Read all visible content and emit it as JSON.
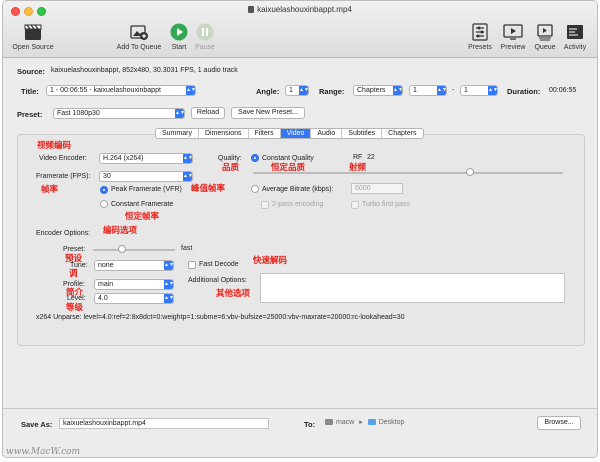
{
  "window": {
    "title": "kaixuelashouxinbappt.mp4"
  },
  "toolbar": {
    "open_source": "Open Source",
    "add_to_queue": "Add To Queue",
    "start": "Start",
    "pause": "Pause",
    "presets": "Presets",
    "preview": "Preview",
    "queue": "Queue",
    "activity": "Activity"
  },
  "source": {
    "label": "Source:",
    "value": "kaixuelashouxinbappt, 852x480, 30.3031 FPS, 1 audio track"
  },
  "title_row": {
    "label": "Title:",
    "title_value": "1 - 00:06:55 - kaixuelashouxinbappt",
    "angle_label": "Angle:",
    "angle_value": "1",
    "range_label": "Range:",
    "range_type": "Chapters",
    "range_from": "1",
    "range_dash": "-",
    "range_to": "1",
    "duration_label": "Duration:",
    "duration_value": "00:06:55"
  },
  "preset_row": {
    "label": "Preset:",
    "value": "Fast 1080p30",
    "reload": "Reload",
    "save_new": "Save New Preset..."
  },
  "tabs": [
    "Summary",
    "Dimensions",
    "Filters",
    "Video",
    "Audio",
    "Subtitles",
    "Chapters"
  ],
  "active_tab": "Video",
  "video": {
    "encoder_label": "Video Encoder:",
    "encoder_value": "H.264 (x264)",
    "framerate_label": "Framerate (FPS):",
    "framerate_value": "30",
    "peak_framerate": "Peak Framerate (VFR)",
    "constant_framerate": "Constant Framerate",
    "quality_label": "Quality:",
    "constant_quality": "Constant Quality",
    "rf_label": "RF",
    "rf_value": "22",
    "rf_level": 0.7,
    "average_bitrate": "Average Bitrate (kbps):",
    "bitrate_value": "6000",
    "two_pass": "2-pass encoding",
    "turbo_first_pass": "Turbo first pass"
  },
  "encoder_options": {
    "heading": "Encoder Options:",
    "preset_label": "Preset:",
    "preset_value": "fast",
    "preset_level": 0.35,
    "tune_label": "Tune:",
    "tune_value": "none",
    "fast_decode": "Fast Decode",
    "profile_label": "Profile:",
    "profile_value": "main",
    "level_label": "Level:",
    "level_value": "4.0",
    "additional_label": "Additional Options:",
    "unparse": "x264 Unparse: level=4.0:ref=2:8x8dct=0:weightp=1:subme=6:vbv-bufsize=25000:vbv-maxrate=20000:rc-lookahead=30"
  },
  "footer": {
    "save_as_label": "Save As:",
    "save_as_value": "kaixuelashouxinbappt.mp4",
    "to_label": "To:",
    "path_user": "macw",
    "path_sep": "▸",
    "path_folder": "Desktop",
    "browse": "Browse..."
  },
  "annotations": {
    "video_codec": "视频编码",
    "quality": "品质",
    "constant_quality": "恒定品质",
    "rf": "射频",
    "framerate": "帧率",
    "peak_framerate": "峰值帧率",
    "constant_framerate": "恒定帧率",
    "encoder_options": "编码选项",
    "preset": "预设",
    "tune": "调",
    "profile": "简介",
    "level": "等级",
    "fast_decode": "快速解码",
    "additional_options": "其他选项"
  },
  "watermark": "www.MacW.com",
  "colors": {
    "accent": "#3478f6",
    "annotation": "#e8201a",
    "start_green": "#34a853"
  }
}
